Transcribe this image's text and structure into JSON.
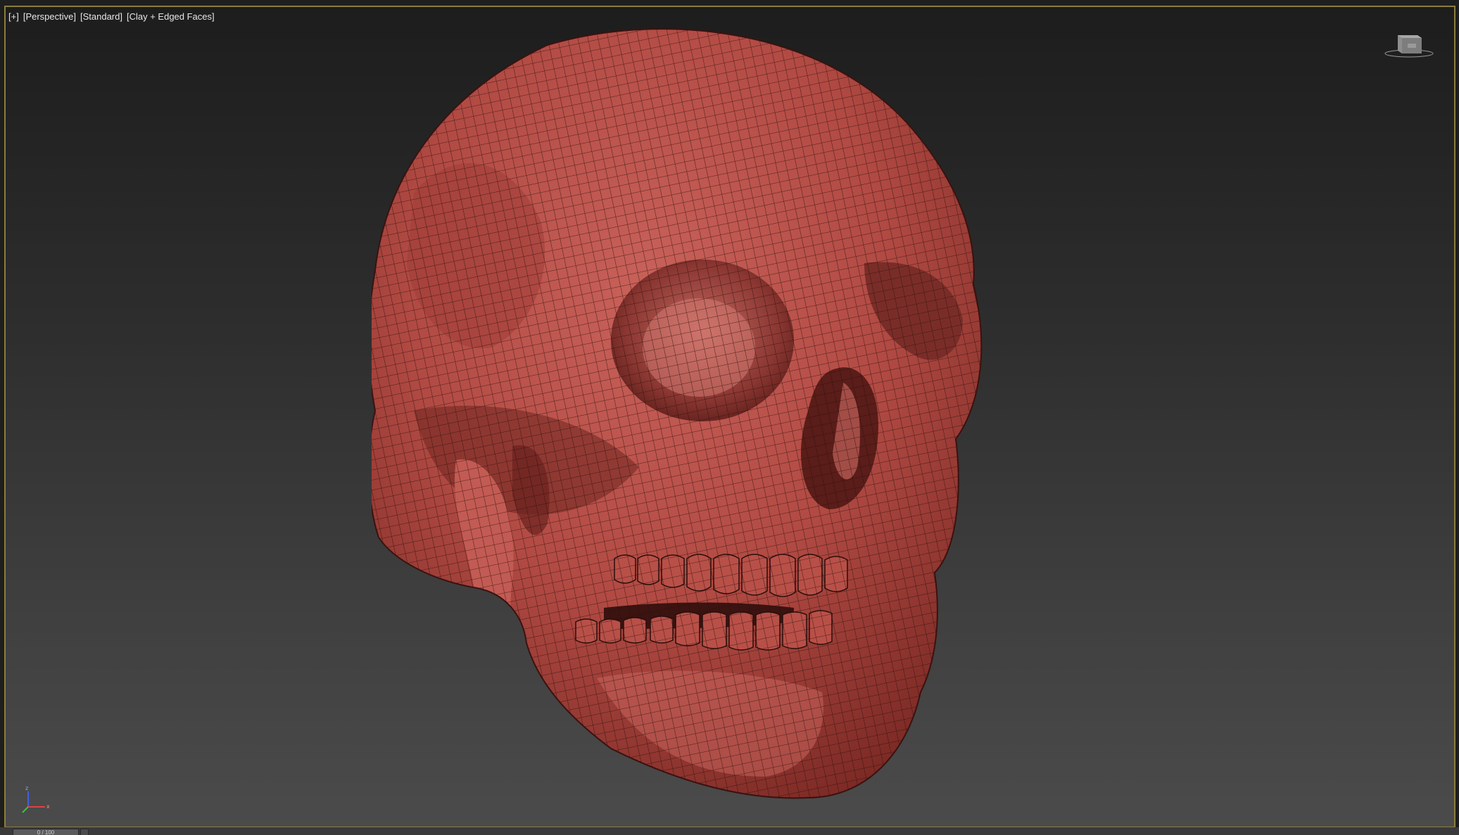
{
  "viewport": {
    "label_plus": "[+]",
    "label_view": "[Perspective]",
    "label_shading": "[Standard]",
    "label_display": "[Clay + Edged Faces]"
  },
  "model": {
    "name": "skull",
    "material_color": "#b85048",
    "wire_color": "#2a0e0b"
  },
  "colors": {
    "active_border": "#8a7d3c",
    "axis_x": "#e04040",
    "axis_y": "#40c040",
    "axis_z": "#4060e0"
  },
  "timeline": {
    "frame_text": "0 / 100"
  }
}
